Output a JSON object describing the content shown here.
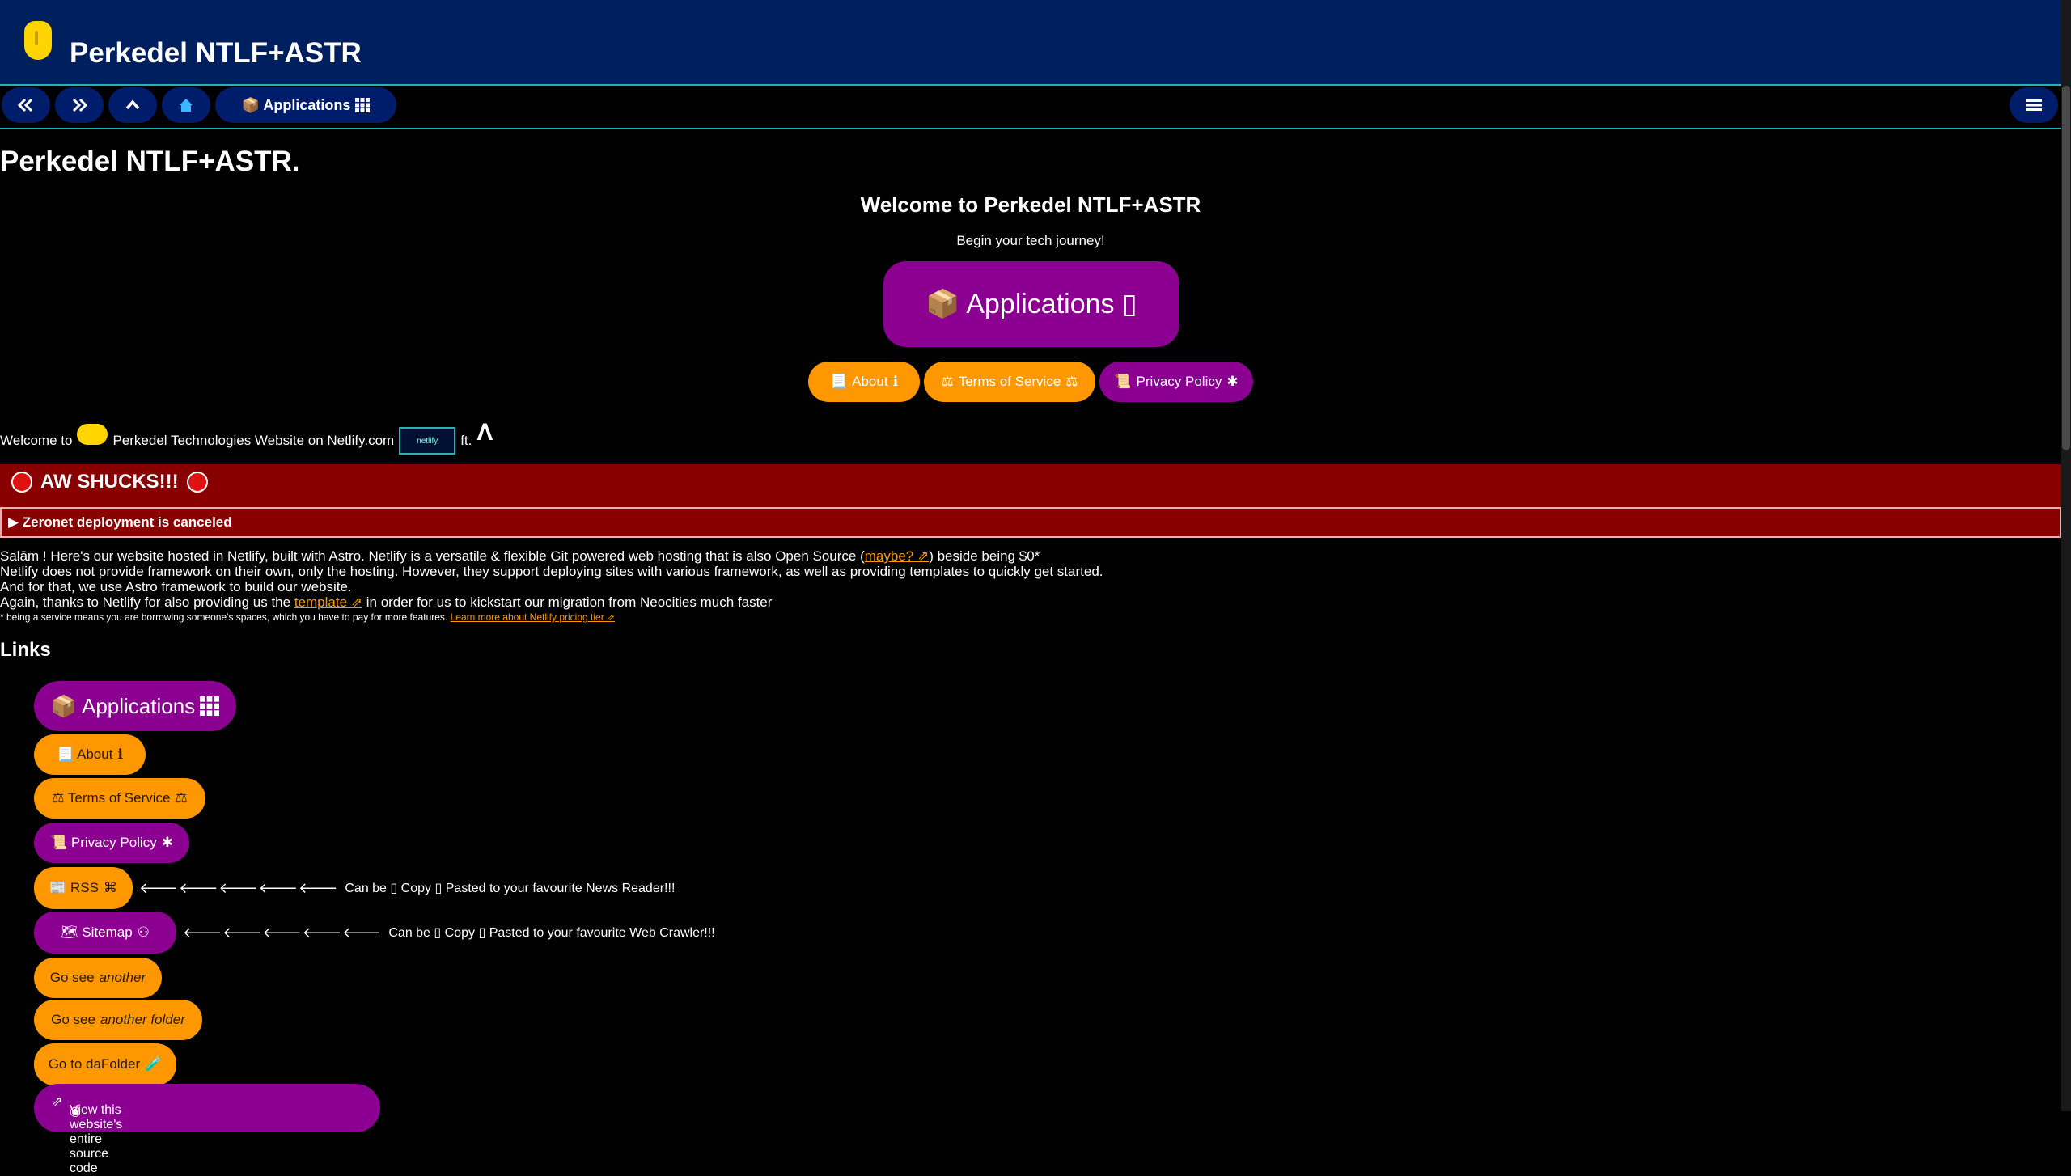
{
  "header": {
    "title": "Perkedel NTLF+ASTR"
  },
  "nav": {
    "apps_label": "📦 Applications",
    "menu_icon": "hamburger-icon"
  },
  "main": {
    "heading": "Perkedel NTLF+ASTR.",
    "welcome_title": "Welcome to Perkedel NTLF+ASTR",
    "welcome_sub": "Begin your tech journey!",
    "big_apps_label": "📦 Applications ▯",
    "buttons": [
      {
        "label": "About",
        "emoji": "📃"
      },
      {
        "label": "Terms of Service",
        "emoji": "⚖"
      },
      {
        "label": "Privacy Policy",
        "emoji": "📜"
      }
    ],
    "welcome_line": {
      "prefix": "Welcome to",
      "middle": "Perkedel Technologies Website on Netlify.com",
      "badge": "netlify",
      "suffix": "ft."
    }
  },
  "alert": {
    "title": "AW SHUCKS!!!",
    "details": "▶ Zeronet deployment is canceled"
  },
  "body": {
    "line1_a": "Salām ! Here's our website hosted in Netlify, built with Astro. Netlify is a versatile & flexible Git powered web hosting that is also Open Source (",
    "line1_link": "maybe?",
    "line1_b": ") beside being $0*",
    "line2": "Netlify does not provide framework on their own, only the hosting. However, they support deploying sites with various framework, as well as providing templates to quickly get started.",
    "line3": "And for that, we use Astro framework to build our website.",
    "line4_a": "Again, thanks to Netlify for also providing us the",
    "line4_link": "template",
    "line4_b": "in order for us to kickstart our migration from Neocities much faster",
    "line5_a": "* being a service means you are borrowing someone's spaces, which you have to pay for more features.",
    "line5_link": "Learn more about Netlify pricing tier"
  },
  "links": {
    "heading": "Links",
    "apps": "📦 Applications",
    "about": "📃 About",
    "tos": "⚖ Terms of Service",
    "privacy": "📜 Privacy Policy",
    "rss": "📰 RSS",
    "rss_note": "Can be ▯   Copy ▯   Pasted to your favourite News Reader!!!",
    "sitemap": "🗺 Sitemap",
    "sitemap_note": "Can be ▯   Copy ▯   Pasted to your favourite Web Crawler!!!",
    "arrows": "🡐🡐🡐🡐🡐",
    "see_another_a": "Go see",
    "see_another_b": "another",
    "see_folder_a": "Go see",
    "see_folder_b": "another folder",
    "dafolder": "Go to daFolder",
    "source": "View this website's entire source code"
  },
  "colors": {
    "header": "#001f5f",
    "orange": "#ff9800",
    "purple": "#8b0090",
    "alert": "#880000",
    "teal": "#1fb5b5"
  }
}
